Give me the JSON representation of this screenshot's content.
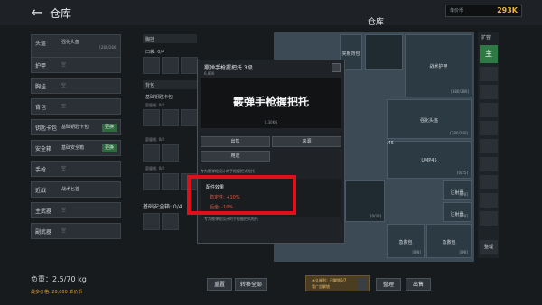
{
  "header": {
    "back_icon": "arrow-left-icon",
    "title": "仓库",
    "money_label": "单价币",
    "money_value": "293K"
  },
  "inventory_title": "仓库",
  "slots": [
    {
      "name": "头盔",
      "value": "强化头盔",
      "sub": "[280/280]"
    },
    {
      "name": "护甲",
      "value": "空"
    },
    {
      "name": "胸挂",
      "value": "空"
    },
    {
      "name": "背包",
      "value": "空"
    },
    {
      "name": "钥匙卡包",
      "value": "基础钥匙卡包",
      "action": "更换"
    },
    {
      "name": "安全箱",
      "value": "基础安全箱",
      "action": "更换"
    },
    {
      "name": "手枪",
      "value": "空"
    },
    {
      "name": "近战",
      "value": "战术匕首"
    },
    {
      "name": "主武器",
      "value": "空"
    },
    {
      "name": "副武器",
      "value": "空"
    }
  ],
  "load": {
    "text": "负重：2.5/70 kg",
    "sub": "最多价格: 20,000 单价币"
  },
  "middle": {
    "pouch_header": "胸挂",
    "pouch_label": "口袋: 0/4",
    "backpack_header": "背包",
    "keycard_label": "基础钥匙卡包",
    "capacity1": "容量格: 0/4",
    "capacity2": "容量格: 0/4",
    "capacity3": "容量格: 0/4",
    "safe_label": "基础安全箱: 0/4"
  },
  "grid_items": {
    "small_item": "夹板背包",
    "item_a": "战术护甲",
    "item_a_sub": "[380/380]",
    "item_b": "强化头盔",
    "item_b_sub": "[280/280]",
    "item_c": "强化头盔",
    "item_c_sub": "[280/280]",
    "item_d": "UMP45",
    "item_d_sub": "[0/25]",
    "partial_45": ".45",
    "item_e": "注射器",
    "item_e_sub": "[8/8]",
    "item_f": "注射器",
    "item_f_sub": "[8/8]",
    "item_g": "急救包",
    "item_g_sub": "[8/8]",
    "item_h": "急救包",
    "item_h_sub": "[8/8]",
    "partial_30": "[0/30]"
  },
  "sidebar": {
    "label": "扩容",
    "main": "主",
    "bottom": "整理"
  },
  "popup": {
    "title": "霰弹手枪握把托 3级",
    "subtitle": "6,800",
    "name": "霰弹手枪握把托",
    "weight": "0.30KG",
    "btn_sell": "出售",
    "btn_source": "来源",
    "btn_use": "用途",
    "desc": "专为霰弹枪设计的手枪握把式枪托",
    "effect_title": "配件效果",
    "effect_1": "稳定性: +10%",
    "effect_2": "后坐: -10%",
    "footer": "专为霰弹枪设计的手枪握把式枪托"
  },
  "bottom": {
    "reset": "重置",
    "transfer_all": "转移全部",
    "ad_line1": "永久福利：已解锁6/7",
    "ad_line2": "看广告解锁",
    "tidy": "整理",
    "sell": "出售"
  }
}
